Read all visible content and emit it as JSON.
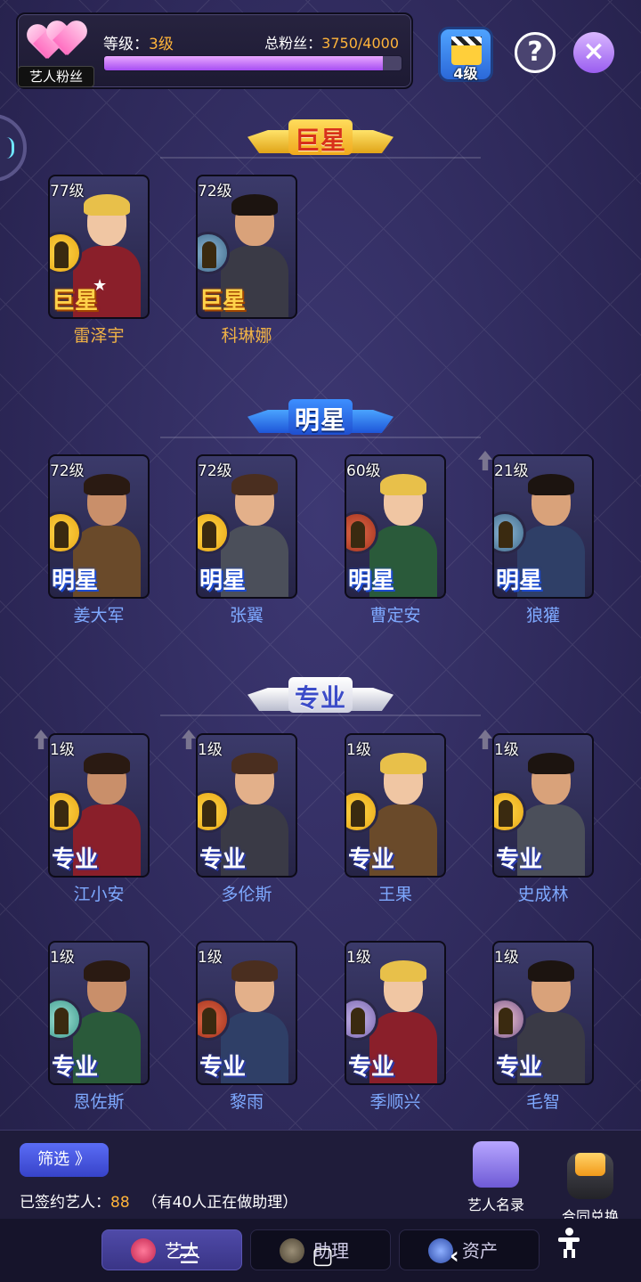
{
  "header": {
    "fan_tag": "艺人粉丝",
    "level_label": "等级：",
    "level_value": "3级",
    "fans_label": "总粉丝：",
    "fans_value": "3750/4000",
    "fans_progress": 0.9375,
    "studio_level": "4级"
  },
  "sections": {
    "superstar": "巨星",
    "star": "明星",
    "pro": "专业"
  },
  "superstars": [
    {
      "level": "77级",
      "rank": "巨星",
      "name": "雷泽宇",
      "badge": "yellow"
    },
    {
      "level": "72级",
      "rank": "巨星",
      "name": "科琳娜",
      "badge": "blue"
    }
  ],
  "stars": [
    {
      "level": "72级",
      "rank": "明星",
      "name": "姜大军",
      "badge": "yellow"
    },
    {
      "level": "72级",
      "rank": "明星",
      "name": "张翼",
      "badge": "yellow"
    },
    {
      "level": "60级",
      "rank": "明星",
      "name": "曹定安",
      "badge": "red"
    },
    {
      "level": "21级",
      "rank": "明星",
      "name": "狼獾",
      "badge": "blue"
    }
  ],
  "pros_row1": [
    {
      "level": "1级",
      "rank": "专业",
      "name": "江小安",
      "badge": "yellow"
    },
    {
      "level": "1级",
      "rank": "专业",
      "name": "多伦斯",
      "badge": "yellow"
    },
    {
      "level": "1级",
      "rank": "专业",
      "name": "王果",
      "badge": "yellow"
    },
    {
      "level": "1级",
      "rank": "专业",
      "name": "史成林",
      "badge": "yellow"
    }
  ],
  "pros_row2": [
    {
      "level": "1级",
      "rank": "专业",
      "name": "恩佐斯",
      "badge": "teal"
    },
    {
      "level": "1级",
      "rank": "专业",
      "name": "黎雨",
      "badge": "red"
    },
    {
      "level": "1级",
      "rank": "专业",
      "name": "季顺兴",
      "badge": "purple"
    },
    {
      "level": "1级",
      "rank": "专业",
      "name": "毛智",
      "badge": "dusk"
    }
  ],
  "footer": {
    "filter_label": "筛选 》",
    "signed_label": "已签约艺人：",
    "signed_count": "88",
    "assistant_note": "（有40人正在做助理）",
    "roster_label": "艺人名录",
    "contract_label": "合同兑换"
  },
  "tabs": [
    {
      "label": "艺人"
    },
    {
      "label": "助理"
    },
    {
      "label": "资产"
    }
  ],
  "colors": {
    "accent_orange": "#ffb43a",
    "progress_purple": "#a64df2",
    "superstar_gold": "#f0b246",
    "star_blue": "#7ea9ff"
  }
}
